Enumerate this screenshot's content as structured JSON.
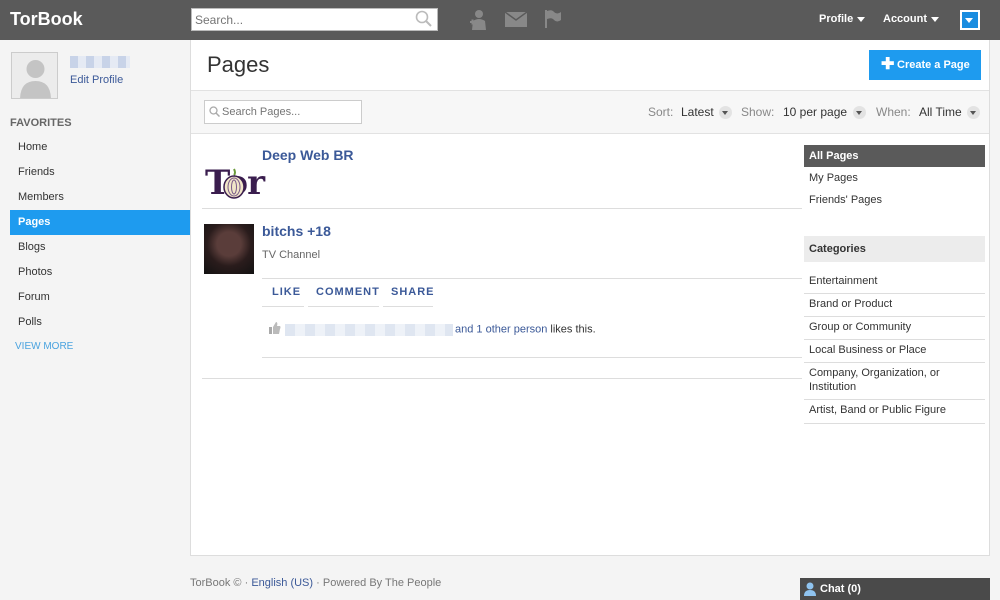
{
  "header": {
    "brand": "TorBook",
    "search_placeholder": "Search...",
    "profile_label": "Profile",
    "account_label": "Account"
  },
  "sidebar": {
    "edit_profile": "Edit Profile",
    "favorites_title": "FAVORITES",
    "items": [
      {
        "label": "Home"
      },
      {
        "label": "Friends"
      },
      {
        "label": "Members"
      },
      {
        "label": "Pages"
      },
      {
        "label": "Blogs"
      },
      {
        "label": "Photos"
      },
      {
        "label": "Forum"
      },
      {
        "label": "Polls"
      }
    ],
    "active_item": "Pages",
    "view_more": "VIEW MORE"
  },
  "main": {
    "title": "Pages",
    "create_button": "Create a Page",
    "search_placeholder": "Search Pages...",
    "filters": {
      "sort_label": "Sort:",
      "sort_value": "Latest",
      "show_label": "Show:",
      "show_value": "10 per page",
      "when_label": "When:",
      "when_value": "All Time"
    },
    "pages": [
      {
        "title": "Deep Web BR",
        "thumb_text": "Tor"
      },
      {
        "title": "bitchs +18",
        "subtitle": "TV Channel"
      }
    ],
    "actions": {
      "like": "LIKE",
      "comment": "COMMENT",
      "share": "SHARE"
    },
    "likes": {
      "others_link": "and 1 other person",
      "suffix": "likes this."
    }
  },
  "right_sidebar": {
    "views": [
      "All Pages",
      "My Pages",
      "Friends' Pages"
    ],
    "active_view": "All Pages",
    "categories_title": "Categories",
    "categories": [
      "Entertainment",
      "Brand or Product",
      "Group or Community",
      "Local Business or Place",
      "Company, Organization, or Institution",
      "Artist, Band or Public Figure"
    ]
  },
  "footer": {
    "copyright": "TorBook ©",
    "sep1": "·",
    "language": "English (US)",
    "sep2": "·",
    "powered": "Powered By The People"
  },
  "chat": {
    "label": "Chat (0)"
  },
  "colors": {
    "topbar": "#5a5a5a",
    "accent": "#1e9bef",
    "link": "#3b5998"
  }
}
